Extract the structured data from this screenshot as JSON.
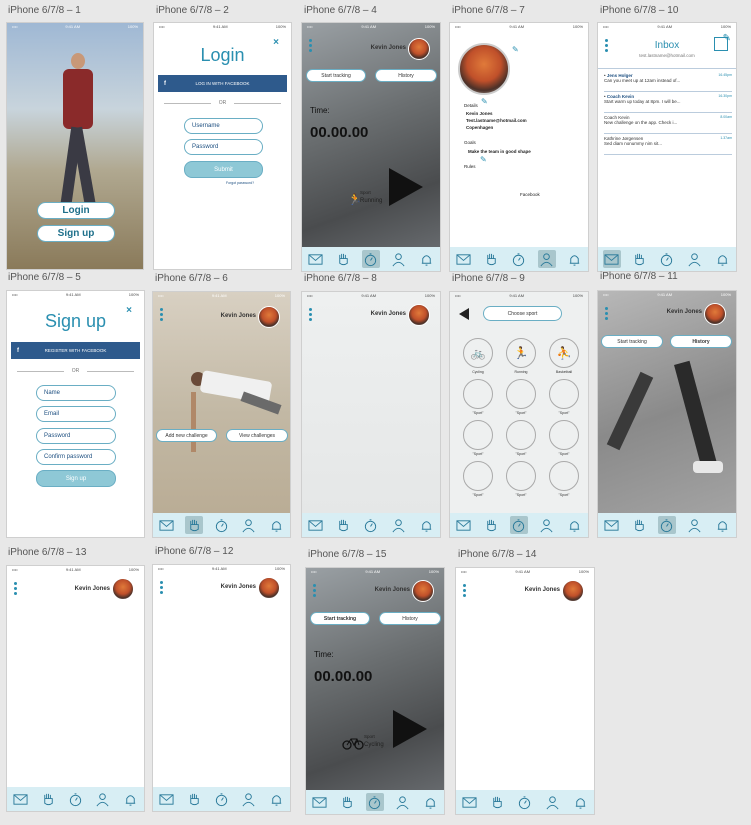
{
  "artboards": {
    "a1": {
      "label": "iPhone 6/7/8 – 1",
      "login": "Login",
      "signup": "Sign up"
    },
    "a2": {
      "label": "iPhone 6/7/8 – 2",
      "title": "Login",
      "close": "×",
      "facebook": "LOG IN WITH FACEBOOK",
      "or": "OR",
      "username": "Username",
      "password": "Password",
      "submit": "Submit",
      "forgot": "Forgot password?"
    },
    "a4": {
      "label": "iPhone 6/7/8 – 4",
      "user": "Kevin Jones",
      "start": "Start tracking",
      "history": "History",
      "time_label": "Time:",
      "time": "00.00.00",
      "sport": "Sport",
      "sport_name": "Running"
    },
    "a7": {
      "label": "iPhone 6/7/8 – 7",
      "details": "Details",
      "name": "Kevin Jones",
      "email": "Test.lastname@hotmail.com",
      "city": "Copenhagen",
      "goals": "Goals",
      "goal": "Make the team in good shape",
      "rules": "Rules",
      "facebook": "Facebook"
    },
    "a10": {
      "label": "iPhone 6/7/8 – 10",
      "title": "Inbox",
      "email": "test.lastname@hotmail.com",
      "messages": [
        {
          "from": "Jens Holger",
          "text": "Can you meet up at 12am instead of...",
          "time": "16.45pm"
        },
        {
          "from": "Coach Kevin",
          "text": "Start warm up today at 8pm. I will be...",
          "time": "16.30pm"
        },
        {
          "from": "Coach Kevin",
          "text": "New challenge on the app. Check i...",
          "time": "8.00am"
        },
        {
          "from": "Kathrine Jørgensen",
          "text": "Sed diam nonummy nim sit...",
          "time": "1.37am"
        }
      ]
    },
    "a5": {
      "label": "iPhone 6/7/8 – 5",
      "title": "Sign up",
      "close": "×",
      "facebook": "REGISTER WITH FACEBOOK",
      "or": "OR",
      "name": "Name",
      "email": "Email",
      "password": "Password",
      "confirm": "Confirm password",
      "signup": "Sign up"
    },
    "a6": {
      "label": "iPhone 6/7/8 – 6",
      "user": "Kevin Jones",
      "add": "Add new challenge",
      "view": "View challenges"
    },
    "a8": {
      "label": "iPhone 6/7/8 – 8",
      "user": "Kevin Jones"
    },
    "a9": {
      "label": "iPhone 6/7/8 – 9",
      "choose": "Choose sport",
      "sports": [
        "Cycling",
        "Running",
        "Basketball",
        "\"Sport\"",
        "\"Sport\"",
        "\"Sport\"",
        "\"Sport\"",
        "\"Sport\"",
        "\"Sport\"",
        "\"Sport\"",
        "\"Sport\"",
        "\"Sport\""
      ]
    },
    "a11": {
      "label": "iPhone 6/7/8 – 11",
      "user": "Kevin Jones",
      "start": "Start tracking",
      "history": "History"
    },
    "a13": {
      "label": "iPhone 6/7/8 – 13",
      "user": "Kevin Jones"
    },
    "a12": {
      "label": "iPhone 6/7/8 – 12",
      "user": "Kevin Jones"
    },
    "a15": {
      "label": "iPhone 6/7/8 – 15",
      "user": "Kevin Jones",
      "start": "Start tracking",
      "history": "History",
      "time_label": "Time:",
      "time": "00.00.00",
      "sport": "Sport",
      "sport_name": "Cycling"
    },
    "a14": {
      "label": "iPhone 6/7/8 – 14",
      "user": "Kevin Jones"
    }
  },
  "status": {
    "carrier": "•••• ",
    "time": "9:41 AM",
    "battery": "100%"
  },
  "colors": {
    "accent": "#2a8fb0",
    "tabbar": "#d8eef4",
    "facebook": "#2e5a8c"
  },
  "tab_icons": [
    "mail-icon",
    "fist-icon",
    "stopwatch-icon",
    "profile-icon",
    "bell-icon"
  ]
}
